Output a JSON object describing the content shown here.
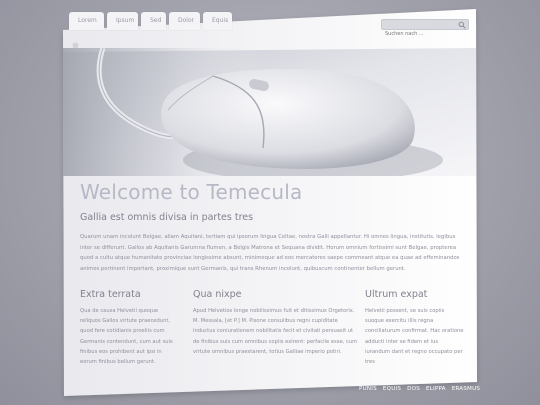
{
  "nav": {
    "tabs": [
      "Lorem",
      "Ipsum",
      "Sed",
      "Dolor",
      "Equis"
    ]
  },
  "search": {
    "placeholder": "Suchen nach ..."
  },
  "icons": {
    "apple": "apple-logo-icon",
    "search": "search-icon"
  },
  "main": {
    "title": "Welcome to Temecula",
    "subtitle": "Gallia est omnis divisa in partes tres",
    "intro": "Quarum unam incolunt Belgae, aliam Aquitani, tertiam qui ipsorum lingua Celtae, nostra Galli appellantur. Hi omnes lingua, institutis, legibus inter se differunt. Gallos ab Aquitanis Garumna flumen, a Belgis Matrona et Sequana dividit. Horum omnium fortissimi sunt Belgae, propterea quod a cultu atque humanitate provinciae longissime absunt, minimeque ad eos mercatores saepe commeant atque ea quae ad effeminandos animos pertinent important, proximique sunt Germanis, qui trans Rhenum incolunt, quibuscum continenter bellum gerunt."
  },
  "columns": [
    {
      "heading": "Extra terrata",
      "text": "Qua de causa Helvetii quoque reliquos Gallos virtute praecedunt, quod fere cotidianis proeliis cum Germanis contendunt, cum aut suis finibus eos prohibent aut ipsi in eorum finibus bellum gerunt."
    },
    {
      "heading": "Qua nixpe",
      "text": "Apud Helvetios longe nobilissimus fuit et ditissimus Orgetorix. M. Messala, [et P.] M. Pisone consulibus regni cupiditate inductus coniurationem nobilitatis fecit et civitati persuasit ut de finibus suis cum omnibus copiis exirent: perfacile esse, cum virtute omnibus praestarent, totius Galliae imperio potiri."
    },
    {
      "heading": "Ultrum expat",
      "text": "Helvetii possent, se suis copiis suoque exercitu illis regna conciliaturum confirmat. Hac oratione adducti inter se fidem et ius iurandum dant et regno occupato per tres"
    }
  ],
  "footer": {
    "links": [
      "PUNIS",
      "EQUIS",
      "DOS",
      "ELIPPA",
      "ERASMUS"
    ]
  },
  "colors": {
    "background": "#a3a4ae",
    "page": "#ffffff",
    "title": "#b7b8c6",
    "text": "#8e8f9b"
  }
}
